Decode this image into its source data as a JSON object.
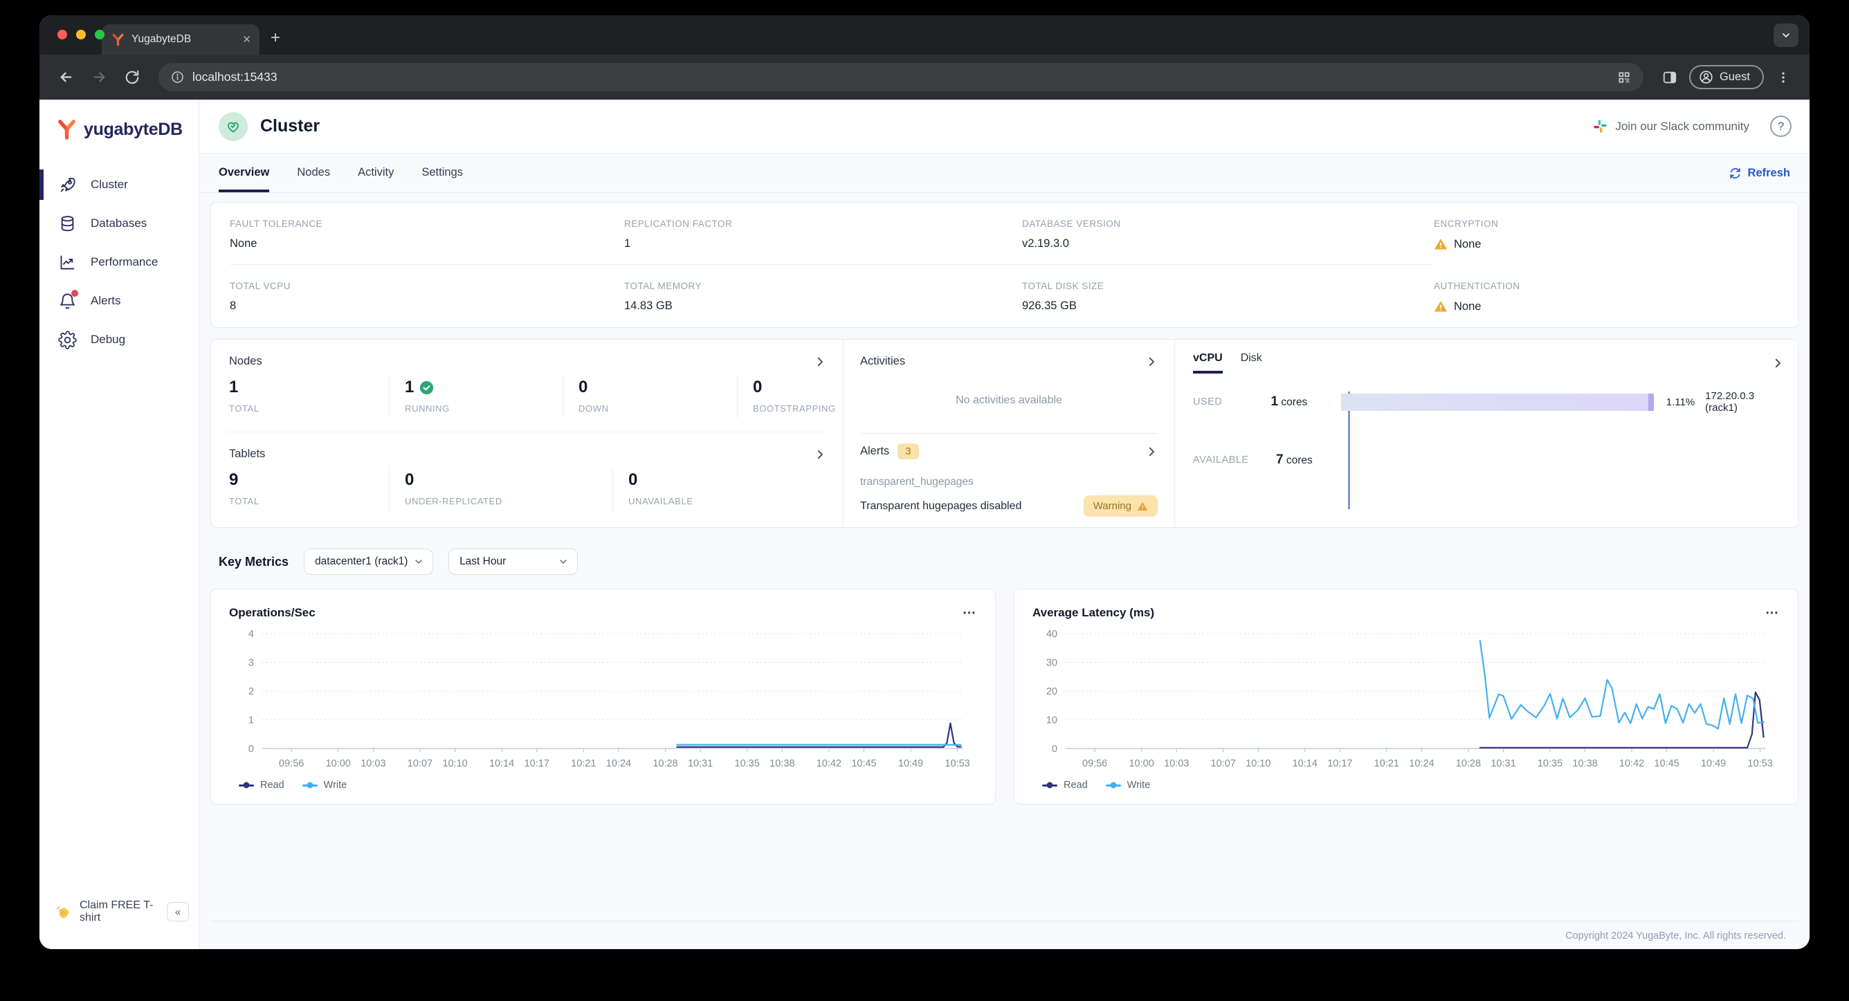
{
  "browser": {
    "tab_title": "YugabyteDB",
    "close_glyph": "✕",
    "new_tab_glyph": "+",
    "url": "localhost:15433",
    "profile_label": "Guest"
  },
  "sidebar": {
    "logo_text": "yugabyteDB",
    "items": [
      {
        "label": "Cluster",
        "active": true
      },
      {
        "label": "Databases",
        "active": false
      },
      {
        "label": "Performance",
        "active": false
      },
      {
        "label": "Alerts",
        "active": false,
        "has_red_dot": true
      },
      {
        "label": "Debug",
        "active": false
      }
    ],
    "tshirt_label": "Claim FREE T-shirt",
    "collapse_glyph": "«"
  },
  "header": {
    "title": "Cluster",
    "slack_label": "Join our Slack community",
    "help_glyph": "?"
  },
  "nav_tabs": {
    "items": [
      "Overview",
      "Nodes",
      "Activity",
      "Settings"
    ],
    "active": "Overview",
    "refresh_label": "Refresh"
  },
  "info_panel": {
    "cells": [
      {
        "label": "FAULT TOLERANCE",
        "value": "None",
        "warning": false
      },
      {
        "label": "REPLICATION FACTOR",
        "value": "1",
        "warning": false
      },
      {
        "label": "DATABASE VERSION",
        "value": "v2.19.3.0",
        "warning": false
      },
      {
        "label": "ENCRYPTION",
        "value": "None",
        "warning": true
      },
      {
        "label": "TOTAL VCPU",
        "value": "8",
        "warning": false
      },
      {
        "label": "TOTAL MEMORY",
        "value": "14.83 GB",
        "warning": false
      },
      {
        "label": "TOTAL DISK SIZE",
        "value": "926.35 GB",
        "warning": false
      },
      {
        "label": "AUTHENTICATION",
        "value": "None",
        "warning": true
      }
    ]
  },
  "nodes_panel": {
    "title": "Nodes",
    "stats": [
      {
        "value": "1",
        "label": "TOTAL",
        "check": false
      },
      {
        "value": "1",
        "label": "RUNNING",
        "check": true
      },
      {
        "value": "0",
        "label": "DOWN",
        "check": false
      },
      {
        "value": "0",
        "label": "BOOTSTRAPPING",
        "check": false
      }
    ]
  },
  "tablets_panel": {
    "title": "Tablets",
    "stats": [
      {
        "value": "9",
        "label": "TOTAL"
      },
      {
        "value": "0",
        "label": "UNDER-REPLICATED"
      },
      {
        "value": "0",
        "label": "UNAVAILABLE"
      }
    ]
  },
  "activities_panel": {
    "title": "Activities",
    "empty_message": "No activities available"
  },
  "alerts_panel": {
    "title": "Alerts",
    "count": "3",
    "alert_name": "transparent_hugepages",
    "alert_description": "Transparent hugepages disabled",
    "severity_label": "Warning"
  },
  "resources_panel": {
    "tabs": [
      "vCPU",
      "Disk"
    ],
    "active_tab": "vCPU",
    "used_label": "USED",
    "used_value": "1",
    "used_unit": "cores",
    "used_percent": "1.11%",
    "used_node": "172.20.0.3 (rack1)",
    "available_label": "AVAILABLE",
    "available_value": "7",
    "available_unit": "cores"
  },
  "key_metrics": {
    "title": "Key Metrics",
    "region_selected": "datacenter1 (rack1)",
    "range_selected": "Last Hour"
  },
  "chart_data": [
    {
      "type": "line",
      "title": "Operations/Sec",
      "ylabel": "",
      "ylim": [
        0,
        4
      ],
      "y_ticks": [
        0,
        1,
        2,
        3,
        4
      ],
      "x_range": [
        53.5,
        113.5
      ],
      "x_ticks": [
        {
          "t": 56,
          "label": "09:56"
        },
        {
          "t": 60,
          "label": "10:00"
        },
        {
          "t": 63,
          "label": "10:03"
        },
        {
          "t": 67,
          "label": "10:07"
        },
        {
          "t": 70,
          "label": "10:10"
        },
        {
          "t": 74,
          "label": "10:14"
        },
        {
          "t": 77,
          "label": "10:17"
        },
        {
          "t": 81,
          "label": "10:21"
        },
        {
          "t": 84,
          "label": "10:24"
        },
        {
          "t": 88,
          "label": "10:28"
        },
        {
          "t": 91,
          "label": "10:31"
        },
        {
          "t": 95,
          "label": "10:35"
        },
        {
          "t": 98,
          "label": "10:38"
        },
        {
          "t": 102,
          "label": "10:42"
        },
        {
          "t": 105,
          "label": "10:45"
        },
        {
          "t": 109,
          "label": "10:49"
        },
        {
          "t": 113,
          "label": "10:53"
        }
      ],
      "grid": "dotted-horizontal",
      "legend_position": "bottom-left",
      "series": [
        {
          "name": "Read",
          "color": "#2f3583",
          "points": [
            [
              89,
              0.05
            ],
            [
              111.8,
              0.05
            ],
            [
              112.1,
              0.2
            ],
            [
              112.4,
              0.88
            ],
            [
              112.7,
              0.2
            ],
            [
              113.0,
              0.06
            ],
            [
              113.3,
              0.06
            ]
          ]
        },
        {
          "name": "Write",
          "color": "#41b0f0",
          "points": [
            [
              89,
              0.13
            ],
            [
              113.3,
              0.13
            ]
          ]
        }
      ]
    },
    {
      "type": "line",
      "title": "Average Latency (ms)",
      "ylabel": "",
      "ylim": [
        0,
        40
      ],
      "y_ticks": [
        0,
        10,
        20,
        30,
        40
      ],
      "x_range": [
        53.5,
        113.5
      ],
      "x_ticks": [
        {
          "t": 56,
          "label": "09:56"
        },
        {
          "t": 60,
          "label": "10:00"
        },
        {
          "t": 63,
          "label": "10:03"
        },
        {
          "t": 67,
          "label": "10:07"
        },
        {
          "t": 70,
          "label": "10:10"
        },
        {
          "t": 74,
          "label": "10:14"
        },
        {
          "t": 77,
          "label": "10:17"
        },
        {
          "t": 81,
          "label": "10:21"
        },
        {
          "t": 84,
          "label": "10:24"
        },
        {
          "t": 88,
          "label": "10:28"
        },
        {
          "t": 91,
          "label": "10:31"
        },
        {
          "t": 95,
          "label": "10:35"
        },
        {
          "t": 98,
          "label": "10:38"
        },
        {
          "t": 102,
          "label": "10:42"
        },
        {
          "t": 105,
          "label": "10:45"
        },
        {
          "t": 109,
          "label": "10:49"
        },
        {
          "t": 113,
          "label": "10:53"
        }
      ],
      "grid": "dotted-horizontal",
      "legend_position": "bottom-left",
      "series": [
        {
          "name": "Read",
          "color": "#2f3583",
          "points": [
            [
              89,
              0.3
            ],
            [
              111.9,
              0.3
            ],
            [
              112.3,
              5
            ],
            [
              112.6,
              19.6
            ],
            [
              112.95,
              17
            ],
            [
              113.3,
              4
            ]
          ]
        },
        {
          "name": "Write",
          "color": "#41b0f0",
          "points": [
            [
              89,
              37.5
            ],
            [
              89.4,
              26
            ],
            [
              89.8,
              10.7
            ],
            [
              90.6,
              18.9
            ],
            [
              91.0,
              18.3
            ],
            [
              91.7,
              10.3
            ],
            [
              92.5,
              15.2
            ],
            [
              93.0,
              13.2
            ],
            [
              93.8,
              10.8
            ],
            [
              94.5,
              14.9
            ],
            [
              95.0,
              19.1
            ],
            [
              95.6,
              10.4
            ],
            [
              96.1,
              17.4
            ],
            [
              96.7,
              10.8
            ],
            [
              97.4,
              13.5
            ],
            [
              98.0,
              17.5
            ],
            [
              98.6,
              11.0
            ],
            [
              99.3,
              11.3
            ],
            [
              99.9,
              23.9
            ],
            [
              100.3,
              21.0
            ],
            [
              100.9,
              9.0
            ],
            [
              101.4,
              12.5
            ],
            [
              101.9,
              8.8
            ],
            [
              102.4,
              15.5
            ],
            [
              102.9,
              10.4
            ],
            [
              103.4,
              14.5
            ],
            [
              103.9,
              13.8
            ],
            [
              104.4,
              19.0
            ],
            [
              104.9,
              8.8
            ],
            [
              105.4,
              14.9
            ],
            [
              105.9,
              13.7
            ],
            [
              106.4,
              9.0
            ],
            [
              106.9,
              15.5
            ],
            [
              107.4,
              12.4
            ],
            [
              107.9,
              15.5
            ],
            [
              108.4,
              8.5
            ],
            [
              108.9,
              8.1
            ],
            [
              109.4,
              6.9
            ],
            [
              109.9,
              17.5
            ],
            [
              110.4,
              8.5
            ],
            [
              110.9,
              19.0
            ],
            [
              111.4,
              8.8
            ],
            [
              111.9,
              18.5
            ],
            [
              112.4,
              17.4
            ],
            [
              112.8,
              8.9
            ],
            [
              113.3,
              9.3
            ]
          ]
        }
      ]
    }
  ],
  "chart_menu_glyph": "⋯",
  "footer": {
    "copyright": "Copyright 2024 YugaByte, Inc. All rights reserved."
  },
  "colors": {
    "accent_navy": "#1b2150",
    "link_blue": "#2757d6",
    "success_green": "#2aa876",
    "warning_orange": "#f0a92e",
    "warning_chip_bg": "#fbe3ae",
    "read_series": "#2f3583",
    "write_series": "#41b0f0",
    "used_bar_start": "#dbe3f3",
    "used_bar_end": "#ddd6f9"
  }
}
